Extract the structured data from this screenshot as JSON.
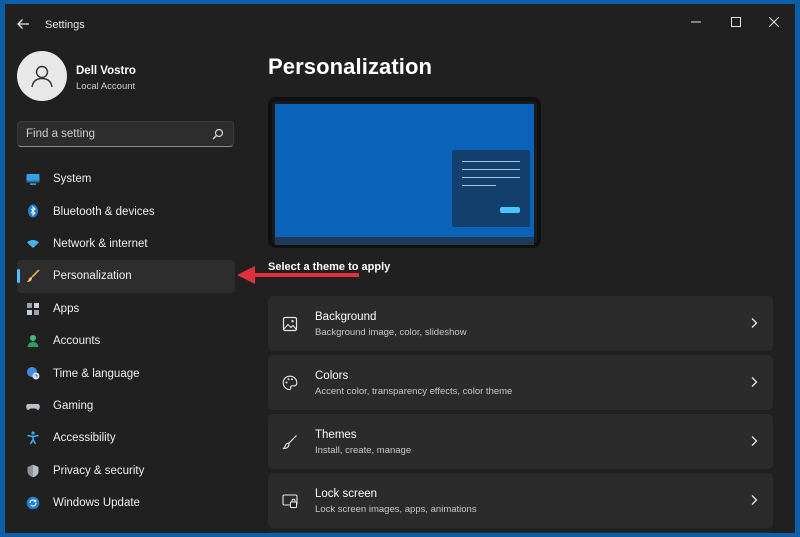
{
  "window": {
    "title": "Settings"
  },
  "user": {
    "name": "Dell Vostro",
    "account_type": "Local Account"
  },
  "search": {
    "placeholder": "Find a setting"
  },
  "sidebar": {
    "items": [
      {
        "label": "System",
        "icon": "display-icon"
      },
      {
        "label": "Bluetooth & devices",
        "icon": "bluetooth-icon"
      },
      {
        "label": "Network & internet",
        "icon": "wifi-icon"
      },
      {
        "label": "Personalization",
        "icon": "brush-icon",
        "selected": true
      },
      {
        "label": "Apps",
        "icon": "apps-icon"
      },
      {
        "label": "Accounts",
        "icon": "person-icon"
      },
      {
        "label": "Time & language",
        "icon": "globe-clock-icon"
      },
      {
        "label": "Gaming",
        "icon": "gamepad-icon"
      },
      {
        "label": "Accessibility",
        "icon": "accessibility-icon"
      },
      {
        "label": "Privacy & security",
        "icon": "shield-icon"
      },
      {
        "label": "Windows Update",
        "icon": "update-icon"
      }
    ]
  },
  "main": {
    "title": "Personalization",
    "theme_prompt": "Select a theme to apply",
    "cards": [
      {
        "title": "Background",
        "subtitle": "Background image, color, slideshow",
        "icon": "image-icon"
      },
      {
        "title": "Colors",
        "subtitle": "Accent color, transparency effects, color theme",
        "icon": "palette-icon"
      },
      {
        "title": "Themes",
        "subtitle": "Install, create, manage",
        "icon": "brush-icon"
      },
      {
        "title": "Lock screen",
        "subtitle": "Lock screen images, apps, animations",
        "icon": "lock-screen-icon"
      }
    ]
  },
  "colors": {
    "accent": "#4cc2ff",
    "annotation_arrow": "#e0303a",
    "window_bg": "#202020",
    "desktop_bg": "#0b5fa8"
  }
}
